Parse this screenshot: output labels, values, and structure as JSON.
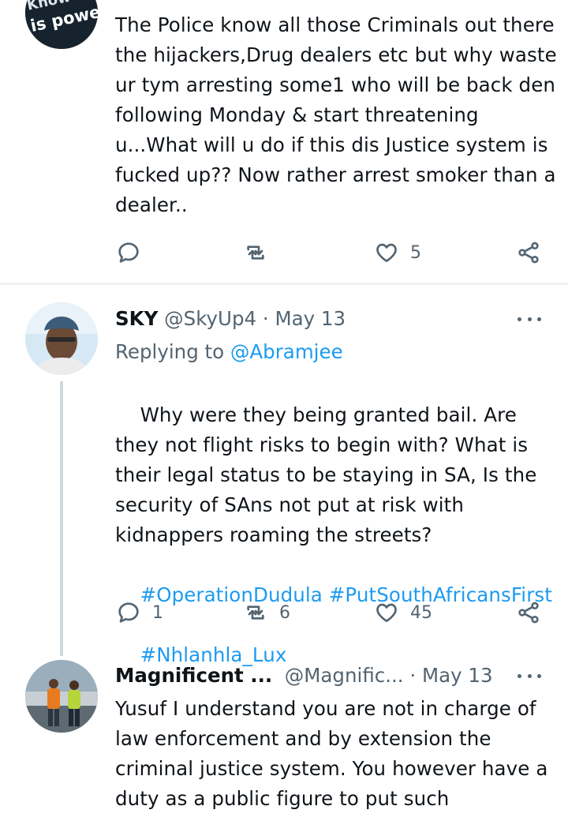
{
  "tweets": [
    {
      "avatar_text_1": "Know",
      "avatar_text_2": "is powe",
      "text": "The Police know all those Criminals out there the hijackers,Drug dealers etc but why waste ur tym arresting some1 who will be back den following Monday & start threatening u...What will u do if this dis Justice system is fucked up?? Now rather arrest smoker than a dealer..",
      "actions": {
        "reply": "",
        "retweet": "",
        "like": "5"
      }
    },
    {
      "name": "SKY",
      "handle": "@SkyUp4 · May 13",
      "replying_prefix": "Replying to",
      "replying_handle": "@Abramjee",
      "text": "Why were they being granted bail. Are they not flight risks to begin with? What is their legal status to be staying in SA, Is the security of SAns not put at risk with kidnappers roaming the streets?",
      "hashtags_line1": "#OperationDudula #PutSouthAfricansFirst",
      "hashtags_line2": "#Nhlanhla_Lux",
      "actions": {
        "reply": "1",
        "retweet": "6",
        "like": "45"
      }
    },
    {
      "name": "Magnificent ...",
      "handle": "@Magnific...",
      "date": "· May 13",
      "text": "Yusuf I understand you are not in charge of law enforcement and by extension the criminal justice system. You however have a duty as a public figure to put such"
    }
  ],
  "icons": [
    "reply-icon",
    "retweet-icon",
    "like-icon",
    "share-icon",
    "more-icon"
  ],
  "colors": {
    "link": "#1d9bf0",
    "secondary": "#536471",
    "divider": "#eff3f4",
    "thread": "#cfd9de"
  }
}
